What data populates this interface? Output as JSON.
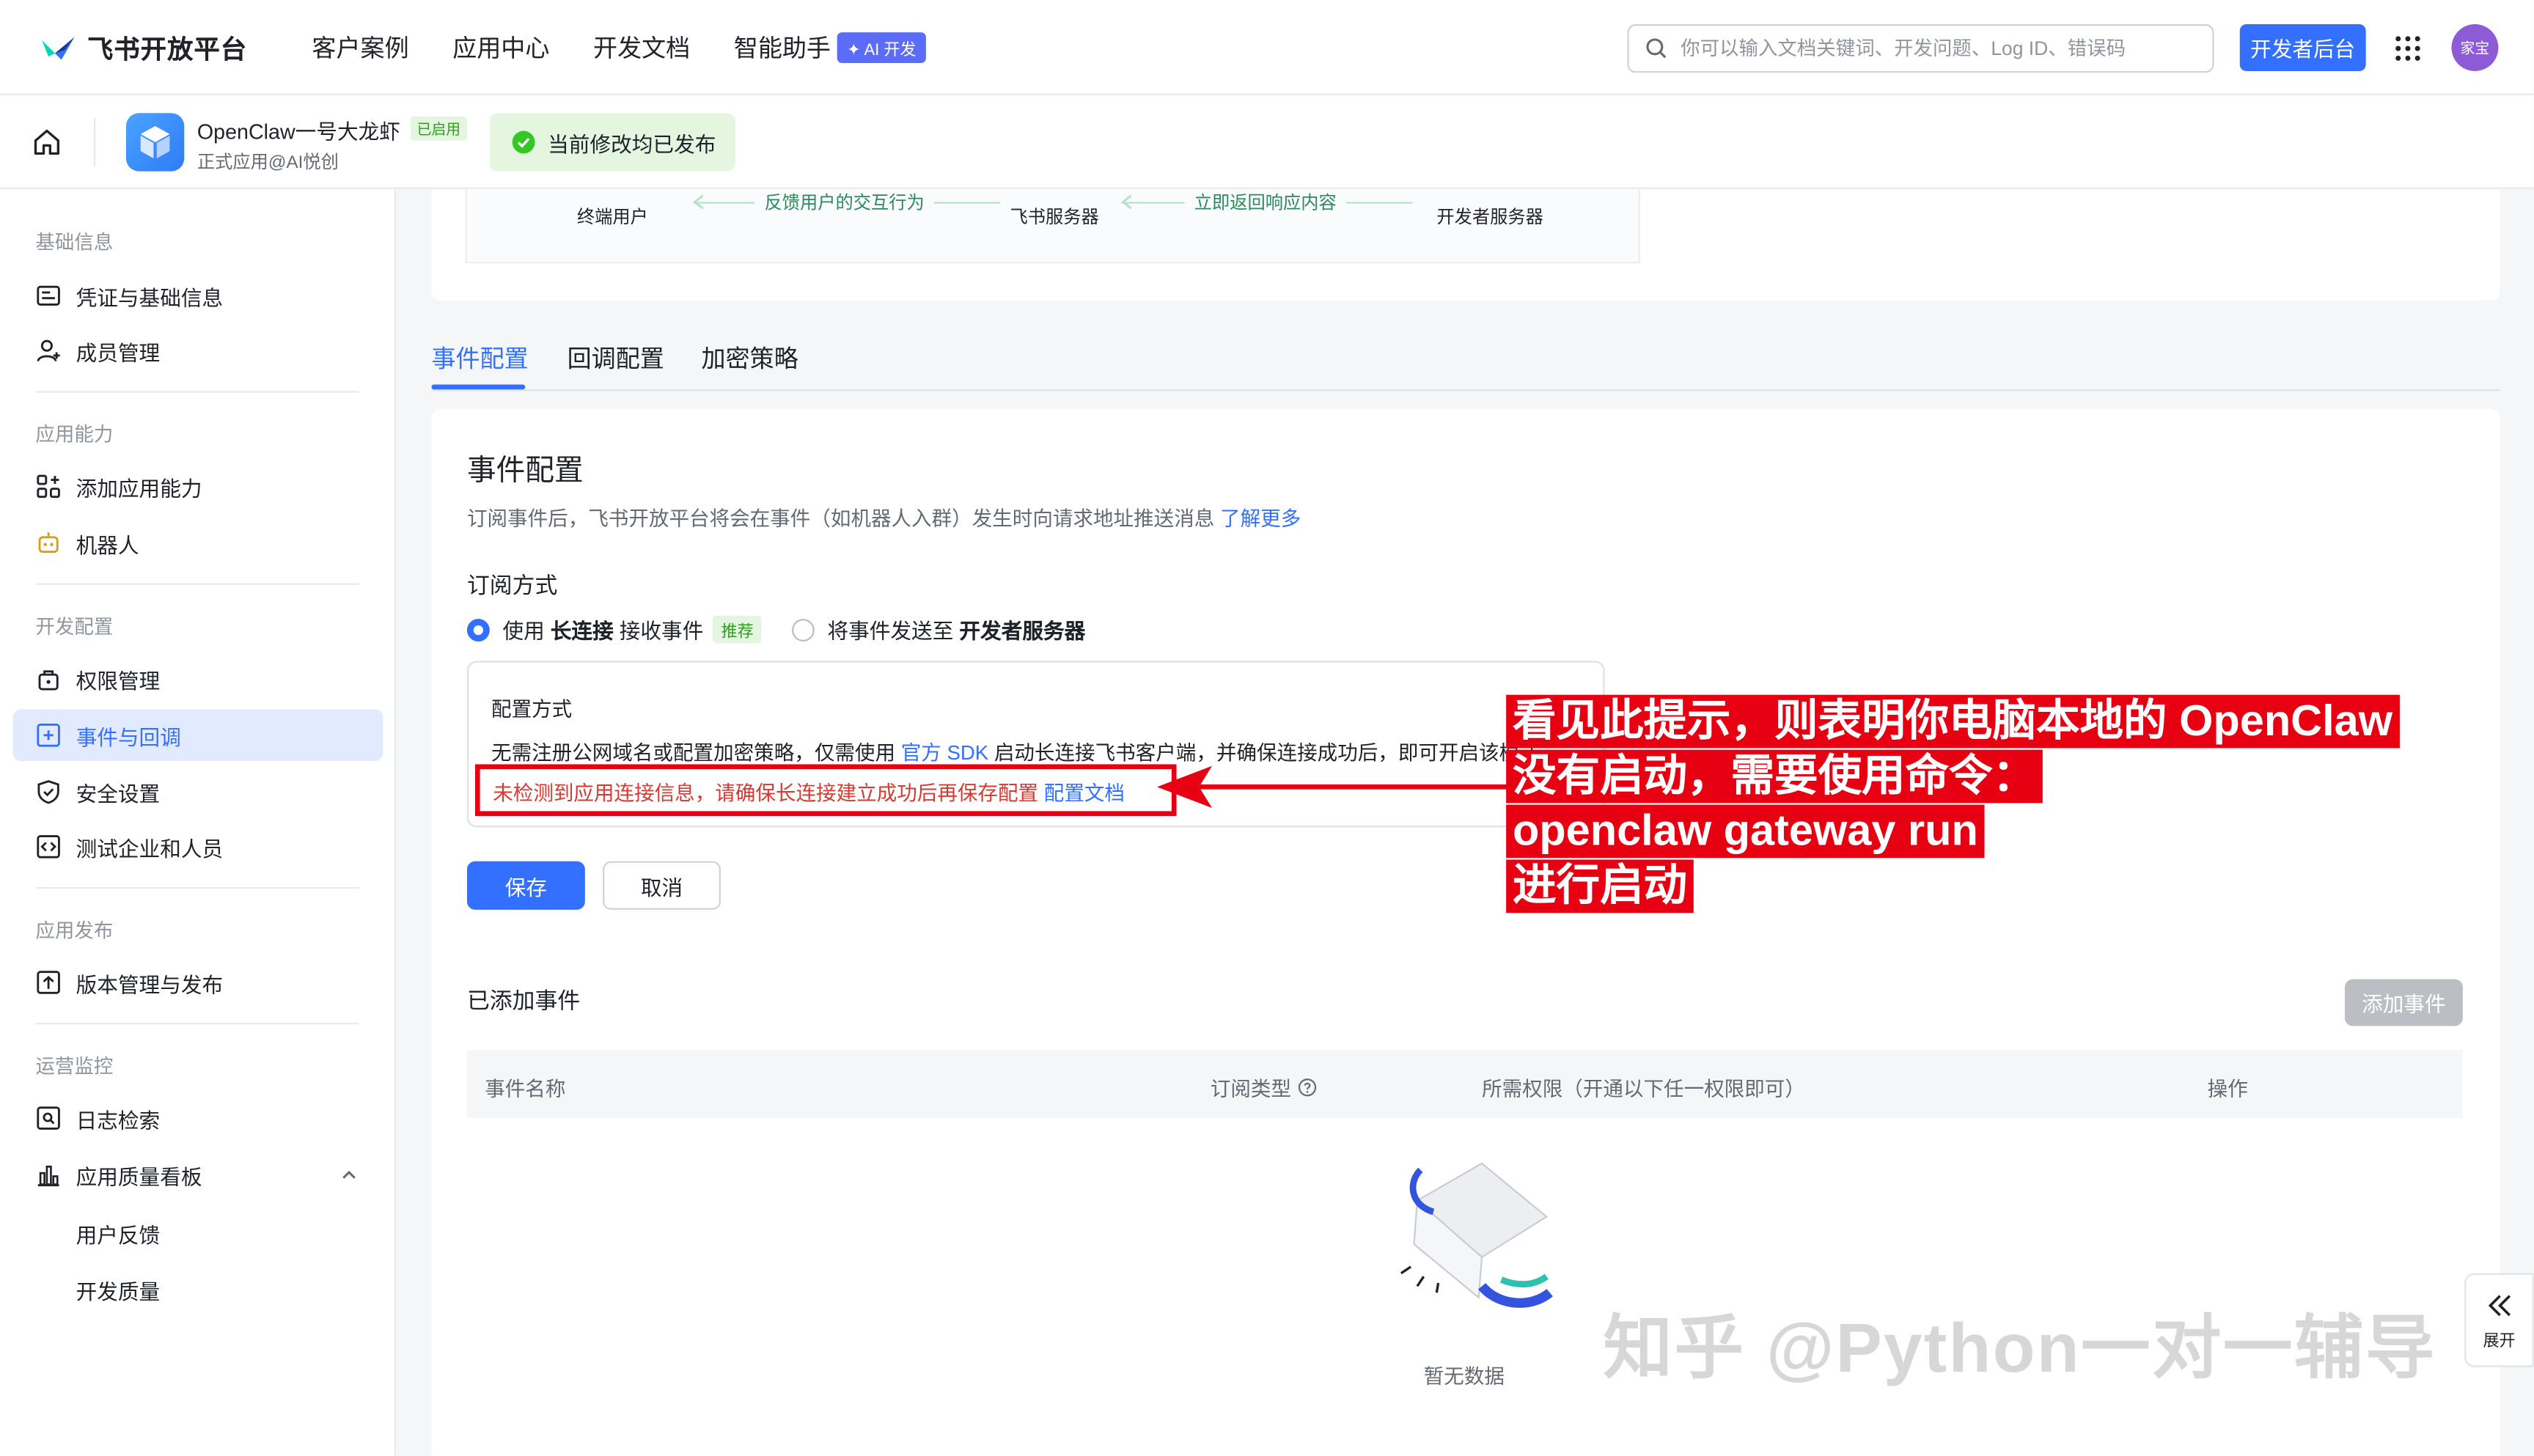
{
  "topnav": {
    "logo": "飞书开放平台",
    "links": [
      "客户案例",
      "应用中心",
      "开发文档",
      "智能助手"
    ],
    "ai_badge": "✦ AI 开发",
    "search_placeholder": "你可以输入文档关键词、开发问题、Log ID、错误码",
    "dev_button": "开发者后台",
    "avatar": "家宝"
  },
  "app_header": {
    "name": "OpenClaw一号大龙虾",
    "status": "已启用",
    "subtitle": "正式应用@AI悦创",
    "publish_toast": "当前修改均已发布"
  },
  "sidebar": {
    "groups": [
      "基础信息",
      "应用能力",
      "开发配置",
      "应用发布",
      "运营监控"
    ],
    "items": [
      {
        "label": "凭证与基础信息",
        "icon": "id-card-icon"
      },
      {
        "label": "成员管理",
        "icon": "user-plus-icon"
      },
      {
        "label": "添加应用能力",
        "icon": "grid-plus-icon"
      },
      {
        "label": "机器人",
        "icon": "robot-icon"
      },
      {
        "label": "权限管理",
        "icon": "lock-icon"
      },
      {
        "label": "事件与回调",
        "icon": "plus-square-icon"
      },
      {
        "label": "安全设置",
        "icon": "shield-icon"
      },
      {
        "label": "测试企业和人员",
        "icon": "code-icon"
      },
      {
        "label": "版本管理与发布",
        "icon": "upload-icon"
      },
      {
        "label": "日志检索",
        "icon": "log-search-icon"
      },
      {
        "label": "应用质量看板",
        "icon": "bar-chart-icon"
      }
    ],
    "sub_items": [
      "用户反馈",
      "开发质量"
    ],
    "active_index": 5
  },
  "flow": {
    "nodes": [
      "终端用户",
      "飞书服务器",
      "开发者服务器"
    ],
    "labels": [
      "反馈用户的交互行为",
      "立即返回响应内容"
    ]
  },
  "tabs": [
    "事件配置",
    "回调配置",
    "加密策略"
  ],
  "event_config": {
    "title": "事件配置",
    "desc": "订阅事件后，飞书开放平台将会在事件（如机器人入群）发生时向请求地址推送消息",
    "desc_link": "了解更多",
    "sub_title": "订阅方式",
    "option1_pre": "使用",
    "option1_bold": "长连接",
    "option1_post": "接收事件",
    "option1_tag": "推荐",
    "option2_pre": "将事件发送至",
    "option2_bold": "开发者服务器",
    "cfg_title": "配置方式",
    "cfg_text_pre": "无需注册公网域名或配置加密策略，仅需使用",
    "cfg_text_link": "官方 SDK",
    "cfg_text_post": "启动长连接飞书客户端，并确保连接成功后，即可开启该模式",
    "warn_text": "未检测到应用连接信息，请确保长连接建立成功后再保存配置",
    "warn_link": "配置文档",
    "save": "保存",
    "cancel": "取消"
  },
  "added_events": {
    "title": "已添加事件",
    "add_button": "添加事件",
    "columns": [
      "事件名称",
      "订阅类型",
      "所需权限（开通以下任一权限即可）",
      "操作"
    ],
    "empty": "暂无数据"
  },
  "annotation": {
    "lines": [
      "看见此提示，则表明你电脑本地的 OpenClaw",
      "没有启动，需要使用命令：",
      "openclaw gateway run",
      "进行启动"
    ]
  },
  "watermark": "知乎 @Python一对一辅导",
  "expand_label": "展开",
  "colors": {
    "accent": "#3370ff",
    "annotation": "#e60012",
    "success": "#2ea121"
  }
}
